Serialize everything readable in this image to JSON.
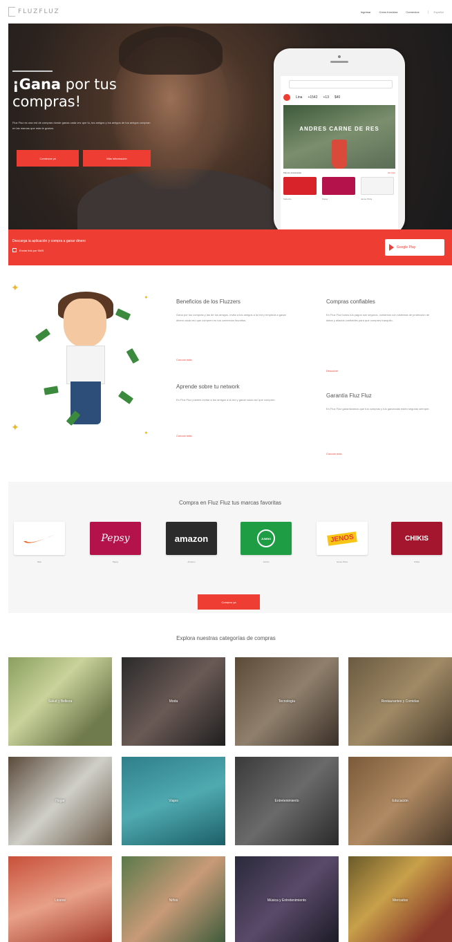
{
  "header": {
    "logo": "FLUZFLUZ",
    "nav": [
      "Ingresar",
      "Cómo funciona",
      "Comercios"
    ],
    "language": "Español"
  },
  "hero": {
    "title_bold": "¡Gana",
    "title_rest": "por tus compras!",
    "body": "Fluz Fluz es una red de compras donde ganas cada vez que tú, tus amigos y los amigos de tus amigos compran en las marcas que más te gustan.",
    "button_primary": "Comienza ya",
    "button_secondary": "Más información"
  },
  "phone": {
    "user": "Lina",
    "stats": [
      "+1542",
      "+13",
      "$40"
    ],
    "banner": "ANDRES CARNE DE RES",
    "section": "Marcas destacadas",
    "section_more": "Ver todo",
    "tile_captions": [
      "Subocho",
      "Pepsy",
      "Jenos Pizza"
    ]
  },
  "appbar": {
    "text": "Descarga la aplicación y compra a ganar dinero",
    "sms": "Enviar link por SMS",
    "store": "Google Play"
  },
  "benefits": {
    "col1_title": "Beneficios de los Fluzzers",
    "col1_text": "Gana por tus compras y las de tus amigos. Invita a tus amigos a la red y empieza a ganar dinero cada vez que compren en tus comercios favoritos.",
    "col1_link": "Conoce más",
    "col2_title": "Aprende sobre tu network",
    "col2_text": "En Fluz Fluz puedes invitar a tus amigos a la red y ganar cada vez que compren.",
    "col2_link": "Conoce más",
    "col3_title": "Compras confiables",
    "col3_text": "En Fluz Fluz todos tus pagos son seguros, contamos con sistemas de protección de datos y aliados confiables para que compres tranquilo.",
    "col3_link": "Descubre",
    "col4_title": "Garantía Fluz Fluz",
    "col4_text": "En Fluz Fluz garantizamos que tus compras y tus ganancias estén seguras siempre.",
    "col4_link": "Conoce más"
  },
  "brands": {
    "title": "Compra en Fluz Fluz tus marcas favoritas",
    "items": [
      {
        "label": "Nike",
        "logo": "swoosh",
        "bg": "#ffffff"
      },
      {
        "label": "Pepsy",
        "logo": "Pepsy",
        "bg": "#b3124a"
      },
      {
        "label": "Amazon",
        "logo": "amazon",
        "bg": "#2b2b2b"
      },
      {
        "label": "Jumbo",
        "logo": "JUMBO",
        "bg": "#1f9d45"
      },
      {
        "label": "Jenos Pizza",
        "logo": "JENOS",
        "bg": "#ffffff"
      },
      {
        "label": "Chikis",
        "logo": "CHIKIS",
        "bg": "#a3162e"
      }
    ],
    "button": "Comprar ya"
  },
  "categories": {
    "title": "Explora nuestras categorías de compras",
    "items": [
      "Salud y Belleza",
      "Moda",
      "Tecnología",
      "Restaurantes y Comidas",
      "Hogar",
      "Viajes",
      "Entretenimiento",
      "Educación",
      "Licores",
      "Niños",
      "Música y Entretenimiento",
      "Mercados"
    ]
  },
  "colors": {
    "accent": "#ee3e34",
    "text": "#555555"
  }
}
